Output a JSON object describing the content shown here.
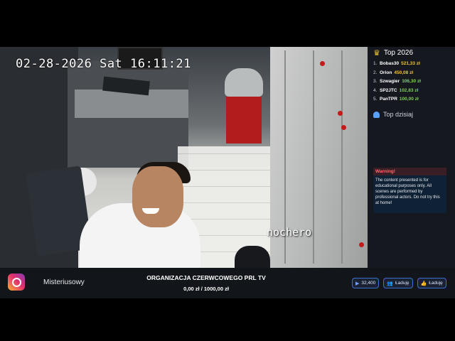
{
  "camera": {
    "timestamp": "02-28-2026 Sat 16:11:21",
    "watermark": "nochero"
  },
  "sidebar": {
    "top_title": "Top 2026",
    "leaderboard": [
      {
        "rank": "1.",
        "name": "Bobas30",
        "amount": "521,33 zł"
      },
      {
        "rank": "2.",
        "name": "Orion",
        "amount": "450,08 zł"
      },
      {
        "rank": "3.",
        "name": "Szwagier",
        "amount": "106,30 zł"
      },
      {
        "rank": "4.",
        "name": "SP2JTC",
        "amount": "102,83 zł"
      },
      {
        "rank": "5.",
        "name": "PanTPR",
        "amount": "100,00 zł"
      }
    ],
    "today_title": "Top dzisiaj",
    "warning": {
      "title": "Warning!",
      "body": "The content presented is for educational purposes only. All scenes are performed by professional actors. Do not try this at home!"
    }
  },
  "bottom_bar": {
    "handle": "Misteriusowy",
    "goal_title": "ORGANIZACJA CZERWCOWEGO PRL TV",
    "goal_current": "0,00 zł",
    "goal_separator": "/",
    "goal_target": "1000,00 zł",
    "pills": [
      {
        "icon": "video-icon",
        "label": "32,400"
      },
      {
        "icon": "users-icon",
        "label": "Ładuję"
      },
      {
        "icon": "thumbs-up-icon",
        "label": "Ładuję"
      }
    ]
  },
  "colors": {
    "gold": "#f2c230",
    "green": "#7fd35a",
    "accent_blue": "#3d6fcf",
    "warning_red": "#ff6a6a"
  }
}
